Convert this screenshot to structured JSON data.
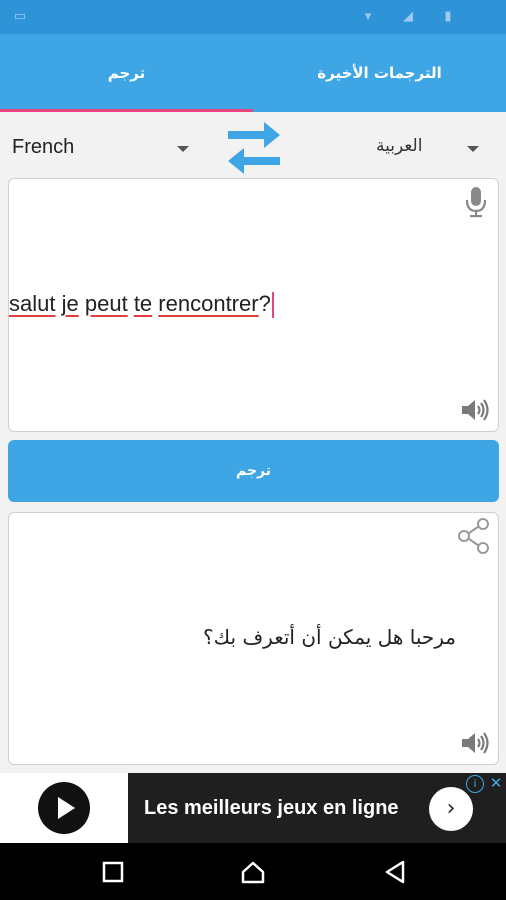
{
  "tabs": {
    "recent_label": "الترجمات الأخيرة",
    "translate_label": "ترجم"
  },
  "languages": {
    "source": "French",
    "target": "العربية"
  },
  "input": {
    "words": [
      "salut",
      "je",
      "peut",
      "te",
      "rencontrer"
    ],
    "trailing": "?"
  },
  "translate_button": {
    "label": "ترجم"
  },
  "output": {
    "text": "مرحبا هل يمكن أن أتعرف بك؟"
  },
  "ad": {
    "title": "Les meilleurs jeux en ligne",
    "arrow": "›",
    "info": "i",
    "close": "✕"
  },
  "colors": {
    "primary": "#3fa6e6",
    "status_bar": "#2f93d8",
    "tab_indicator": "#e8447d",
    "spellcheck": "#e23c3c"
  },
  "icons": {
    "swap": "swap-icon",
    "mic": "microphone-icon",
    "speaker": "speaker-icon",
    "share": "share-icon"
  }
}
